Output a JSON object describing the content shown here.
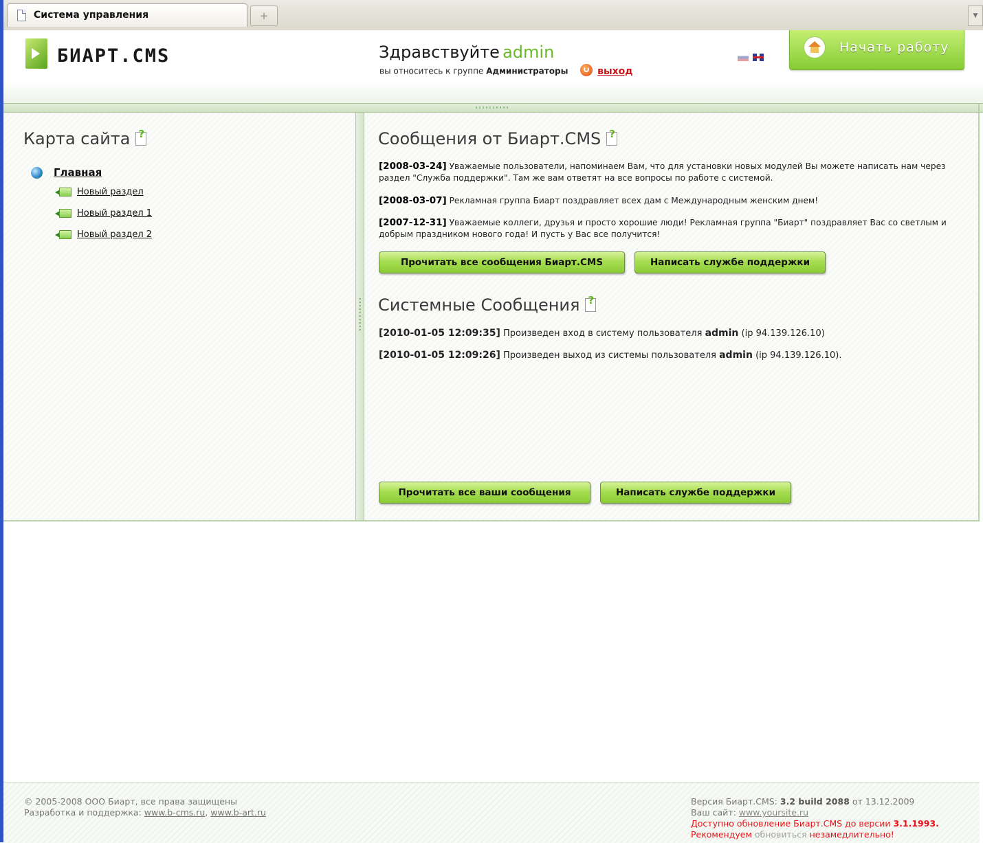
{
  "browser": {
    "tab_title": "Система управления",
    "new_tab_glyph": "+"
  },
  "header": {
    "logo_text": "БИАРТ.CMS",
    "greeting": "Здравствуйте",
    "username": "admin",
    "group_prefix": "вы относитесь к группе",
    "group_name": "Администраторы",
    "logout_label": "выход",
    "start_button_label": "Начать работу"
  },
  "sitemap": {
    "title": "Карта сайта",
    "root_label": "Главная",
    "items": [
      "Новый раздел",
      "Новый раздел 1",
      "Новый раздел 2"
    ]
  },
  "news": {
    "title": "Сообщения от Биарт.CMS",
    "items": [
      {
        "date": "[2008-03-24]",
        "text": "Уважаемые пользователи, напоминаем Вам, что для установки новых модулей Вы можете написать нам через раздел \"Служба поддержки\". Там же вам ответят на все вопросы по работе с системой."
      },
      {
        "date": "[2008-03-07]",
        "text": "Рекламная группа Биарт поздравляет всех дам с Международным женским днем!"
      },
      {
        "date": "[2007-12-31]",
        "text": "Уважаемые коллеги, друзья и просто хорошие люди! Рекламная группа \"Биарт\" поздравляет Вас со светлым и добрым праздником нового года! И пусть у Вас все получится!"
      }
    ],
    "read_all_label": "Прочитать все сообщения Биарт.CMS",
    "support_label": "Написать службе поддержки"
  },
  "system": {
    "title": "Системные Сообщения",
    "items": [
      {
        "date": "[2010-01-05 12:09:35]",
        "text_before": "Произведен вход в систему пользователя",
        "user": "admin",
        "text_after": "(ip 94.139.126.10)"
      },
      {
        "date": "[2010-01-05 12:09:26]",
        "text_before": "Произведен выход из системы пользователя",
        "user": "admin",
        "text_after": "(ip 94.139.126.10)."
      }
    ],
    "read_all_label": "Прочитать все ваши сообщения",
    "support_label": "Написать службе поддержки"
  },
  "footer": {
    "copyright": "© 2005-2008 ООО Биарт, все права защищены",
    "dev_prefix": "Разработка и поддержка:",
    "link1": "www.b-cms.ru",
    "link2": "www.b-art.ru",
    "version_prefix": "Версия Биарт.CMS:",
    "version": "3.2 build 2088",
    "version_date": "от 13.12.2009",
    "site_prefix": "Ваш сайт:",
    "site_link": "www.yoursite.ru",
    "update_prefix": "Доступно обновление Биарт.CMS до версии",
    "update_version": "3.1.1993.",
    "recommend_1": "Рекомендуем",
    "recommend_2": "обновиться",
    "recommend_3": "незамедлительно!"
  },
  "colors": {
    "accent_green": "#8ccc35",
    "username_green": "#6bb82a",
    "logout_red": "#c8151b",
    "warning_red": "#e8121a"
  }
}
